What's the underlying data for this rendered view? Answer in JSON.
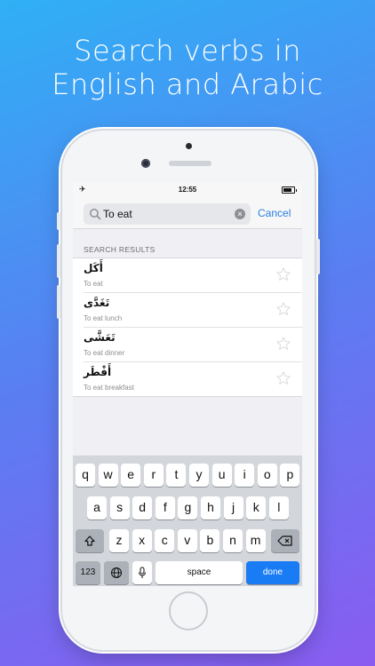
{
  "headline": {
    "line1": "Search verbs in",
    "line2": "English and Arabic"
  },
  "status_bar": {
    "time": "12:55",
    "airplane": "✈"
  },
  "search": {
    "query": "To eat",
    "cancel_label": "Cancel"
  },
  "results": {
    "section_title": "SEARCH RESULTS",
    "items": [
      {
        "arabic": "أَكَل",
        "english": "To eat"
      },
      {
        "arabic": "تَغَدَّى",
        "english": "To eat lunch"
      },
      {
        "arabic": "تَعَشَّى",
        "english": "To eat dinner"
      },
      {
        "arabic": "أَفْطَر",
        "english": "To eat breakfast"
      }
    ]
  },
  "keyboard": {
    "row1": [
      "q",
      "w",
      "e",
      "r",
      "t",
      "y",
      "u",
      "i",
      "o",
      "p"
    ],
    "row2": [
      "a",
      "s",
      "d",
      "f",
      "g",
      "h",
      "j",
      "k",
      "l"
    ],
    "row3": [
      "z",
      "x",
      "c",
      "v",
      "b",
      "n",
      "m"
    ],
    "key_123": "123",
    "space": "space",
    "done": "done"
  },
  "colors": {
    "accent": "#2c7fe6",
    "done_key": "#1a7cf5"
  }
}
